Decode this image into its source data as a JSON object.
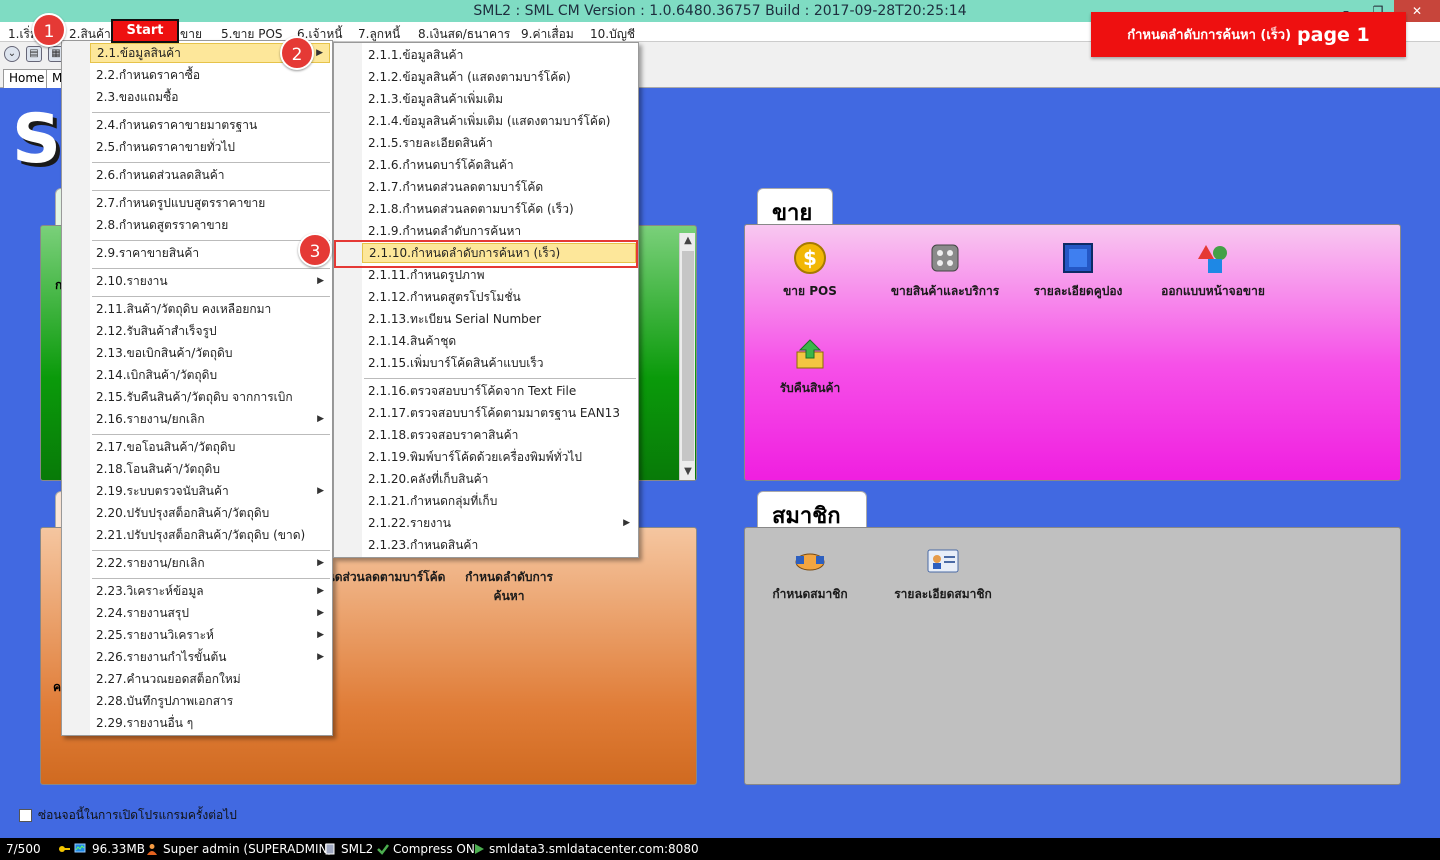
{
  "window": {
    "title": "SML2 : SML CM Version : 1.0.6480.36757  Build : 2017-09-28T20:25:14",
    "minimize": "–",
    "restore": "❐",
    "close": "✕"
  },
  "menubar": [
    "1.เริ่ม",
    "2.สินค้า",
    "ขาย",
    "5.ขาย POS",
    "6.เจ้าหนี้",
    "7.ลูกหนี้",
    "8.เงินสด/ธนาคาร",
    "9.ค่าเสื่อม",
    "10.บัญชี"
  ],
  "tabs": {
    "home": "Home",
    "second": "M"
  },
  "start_label": "Start",
  "banner": {
    "text": "กำหนดลำดับการค้นหา (เร็ว)",
    "page": "page 1"
  },
  "badges": [
    "1",
    "2",
    "3"
  ],
  "bg_letter": "S",
  "panels": {
    "sale_title": "ขาย",
    "member_title": "สมาชิก",
    "sale_tiles": [
      "ขาย POS",
      "ขายสินค้าและบริการ",
      "รายละเอียดคูปอง",
      "ออกแบบหน้าจอขาย",
      "รับคืนสินค้า"
    ],
    "member_tiles": [
      "กำหนดสมาชิก",
      "รายละเอียดสมาชิก"
    ],
    "orange_tiles": [
      "กำหนดส่วนลดตามบาร์โค้ด",
      "กำหนดลำดับการค้นหา"
    ],
    "green_partial": "ก",
    "orange_partial": "ค"
  },
  "menu_level1": [
    "2.1.ข้อมูลสินค้า",
    "2.2.กำหนดราคาซื้อ",
    "2.3.ของแถมซื้อ",
    "2.4.กำหนดราคาขายมาตรฐาน",
    "2.5.กำหนดราคาขายทั่วไป",
    "2.6.กำหนดส่วนลดสินค้า",
    "2.7.กำหนดรูปแบบสูตรราคาขาย",
    "2.8.กำหนดสูตรราคาขาย",
    "2.9.ราคาขายสินค้า",
    "2.10.รายงาน",
    "2.11.สินค้า/วัตถุดิบ คงเหลือยกมา",
    "2.12.รับสินค้าสำเร็จรูป",
    "2.13.ขอเบิกสินค้า/วัตถุดิบ",
    "2.14.เบิกสินค้า/วัตถุดิบ",
    "2.15.รับคืนสินค้า/วัตถุดิบ จากการเบิก",
    "2.16.รายงาน/ยกเลิก",
    "2.17.ขอโอนสินค้า/วัตถุดิบ",
    "2.18.โอนสินค้า/วัตถุดิบ",
    "2.19.ระบบตรวจนับสินค้า",
    "2.20.ปรับปรุงสต็อกสินค้า/วัตถุดิบ",
    "2.21.ปรับปรุงสต็อกสินค้า/วัตถุดิบ (ขาด)",
    "2.22.รายงาน/ยกเลิก",
    "2.23.วิเคราะห์ข้อมูล",
    "2.24.รายงานสรุป",
    "2.25.รายงานวิเคราะห์",
    "2.26.รายงานกำไรขั้นต้น",
    "2.27.คำนวณยอดสต็อกใหม่",
    "2.28.บันทึกรูปภาพเอกสาร",
    "2.29.รายงานอื่น ๆ"
  ],
  "menu_level2": [
    "2.1.1.ข้อมูลสินค้า",
    "2.1.2.ข้อมูลสินค้า (แสดงตามบาร์โค้ด)",
    "2.1.3.ข้อมูลสินค้าเพิ่มเติม",
    "2.1.4.ข้อมูลสินค้าเพิ่มเติม (แสดงตามบาร์โค้ด)",
    "2.1.5.รายละเอียดสินค้า",
    "2.1.6.กำหนดบาร์โค้ดสินค้า",
    "2.1.7.กำหนดส่วนลดตามบาร์โค้ด",
    "2.1.8.กำหนดส่วนลดตามบาร์โค้ด (เร็ว)",
    "2.1.9.กำหนดลำดับการค้นหา",
    "2.1.10.กำหนดลำดับการค้นหา (เร็ว)",
    "2.1.11.กำหนดรูปภาพ",
    "2.1.12.กำหนดสูตรโปรโมชั่น",
    "2.1.13.ทะเบียน Serial Number",
    "2.1.14.สินค้าชุด",
    "2.1.15.เพิ่มบาร์โค้ดสินค้าแบบเร็ว",
    "2.1.16.ตรวจสอบบาร์โค้ดจาก Text File",
    "2.1.17.ตรวจสอบบาร์โค้ดตามมาตรฐาน EAN13",
    "2.1.18.ตรวจสอบราคาสินค้า",
    "2.1.19.พิมพ์บาร์โค้ดด้วยเครื่องพิมพ์ทั่วไป",
    "2.1.20.คลังที่เก็บสินค้า",
    "2.1.21.กำหนดกลุ่มที่เก็บ",
    "2.1.22.รายงาน",
    "2.1.23.กำหนดสินค้า"
  ],
  "checkbox_label": "ซ่อนจอนี้ในการเปิดโปรแกรมครั้งต่อไป",
  "status": {
    "count": "7/500",
    "memory": "96.33MB",
    "user": "Super admin (SUPERADMIN)",
    "app": "SML2",
    "compress": "Compress ON",
    "server": "smldata3.smldatacenter.com:8080"
  },
  "colors": {
    "desktop": "#4169e1",
    "accent": "#ee1010",
    "highlight": "#fde79a"
  }
}
